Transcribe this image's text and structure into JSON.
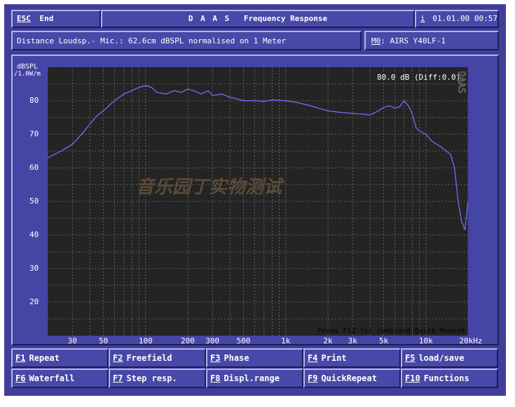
{
  "header": {
    "esc_key": "ESC",
    "esc_label": "End",
    "title_app": "D A A S",
    "title_view": "Frequency Response",
    "info_key": "i",
    "datetime": "01.01.00 00:57"
  },
  "info_bar": {
    "description": "Distance Loudsp.- Mic.: 62.6cm dBSPL normalised on 1 Meter",
    "mem_key": "M0",
    "mem_value": ": AIRS Y40LF-1"
  },
  "plot": {
    "ylabel_line1": "dBSPL",
    "ylabel_line2": "/1.0W/m",
    "readout": "80.0 dB (Diff:0.0)",
    "vertical_brand": "DAAS",
    "watermark": "音乐园丁实物测试",
    "footer_hint": "Press F12 for combined Quick Repeat"
  },
  "chart_data": {
    "type": "line",
    "xscale": "log",
    "xlim": [
      20,
      20000
    ],
    "ylim": [
      10,
      90
    ],
    "y_ticks": [
      20,
      30,
      40,
      50,
      60,
      70,
      80
    ],
    "x_ticks": [
      {
        "value": 30,
        "label": "30"
      },
      {
        "value": 50,
        "label": "50"
      },
      {
        "value": 100,
        "label": "100"
      },
      {
        "value": 200,
        "label": "200"
      },
      {
        "value": 300,
        "label": "300"
      },
      {
        "value": 500,
        "label": "500"
      },
      {
        "value": 1000,
        "label": "1k"
      },
      {
        "value": 2000,
        "label": "2k"
      },
      {
        "value": 3000,
        "label": "3k"
      },
      {
        "value": 5000,
        "label": "5k"
      },
      {
        "value": 10000,
        "label": "10k"
      },
      {
        "value": 20000,
        "label": "20kHz"
      }
    ],
    "grid": true,
    "line_color": "#6a6aee",
    "series": [
      {
        "x": [
          20,
          25,
          30,
          35,
          40,
          45,
          50,
          60,
          70,
          80,
          90,
          100,
          110,
          120,
          140,
          160,
          180,
          200,
          220,
          250,
          280,
          300,
          350,
          400,
          450,
          500,
          600,
          700,
          800,
          1000,
          1200,
          1500,
          1800,
          2000,
          2500,
          3000,
          3500,
          4000,
          4500,
          5000,
          5500,
          6000,
          6500,
          7000,
          7500,
          8000,
          8500,
          9000,
          10000,
          11000,
          12000,
          13000,
          14000,
          15000,
          16000,
          17000,
          18000,
          19000,
          20000
        ],
        "values": [
          63,
          65,
          67,
          70,
          73,
          75.5,
          77,
          80,
          82,
          83,
          84,
          84.5,
          84,
          82.5,
          82,
          83,
          82.5,
          83.5,
          83,
          82,
          83,
          81.5,
          82,
          81,
          80.5,
          80,
          80,
          79.8,
          80.2,
          80,
          79.5,
          78.5,
          77.5,
          77,
          76.5,
          76.2,
          76,
          75.8,
          76.8,
          78,
          78.5,
          77.8,
          78.2,
          80,
          78.5,
          76,
          72,
          71,
          70,
          68,
          67,
          66,
          65,
          64,
          60,
          50,
          44,
          41.5,
          50
        ]
      }
    ]
  },
  "fkeys": [
    {
      "key": "F1",
      "label": "Repeat"
    },
    {
      "key": "F2",
      "label": "Freefield"
    },
    {
      "key": "F3",
      "label": "Phase"
    },
    {
      "key": "F4",
      "label": "Print"
    },
    {
      "key": "F5",
      "label": "load/save"
    },
    {
      "key": "F6",
      "label": "Waterfall"
    },
    {
      "key": "F7",
      "label": "Step resp."
    },
    {
      "key": "F8",
      "label": "Displ.range"
    },
    {
      "key": "F9",
      "label": "QuickRepeat"
    },
    {
      "key": "F10",
      "label": "Functions"
    }
  ]
}
